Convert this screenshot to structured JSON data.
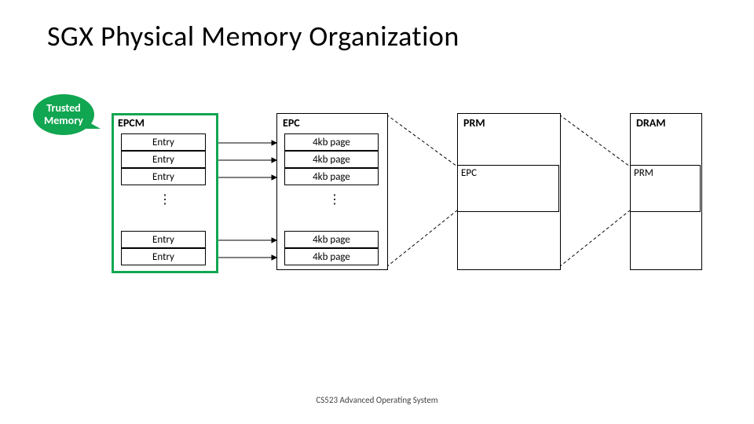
{
  "title": "SGX Physical Memory Organization",
  "footer": "CS523 Advanced Operating System",
  "bubble_line1": "Trusted",
  "bubble_line2": "Memory",
  "epcm": {
    "label": "EPCM",
    "rows_top": [
      "Entry",
      "Entry",
      "Entry"
    ],
    "rows_bot": [
      "Entry",
      "Entry"
    ]
  },
  "epc": {
    "label": "EPC",
    "rows_top": [
      "4kb page",
      "4kb page",
      "4kb page"
    ],
    "rows_bot": [
      "4kb page",
      "4kb page"
    ]
  },
  "prm": {
    "label": "PRM",
    "inner": "EPC"
  },
  "dram": {
    "label": "DRAM",
    "inner": "PRM"
  }
}
